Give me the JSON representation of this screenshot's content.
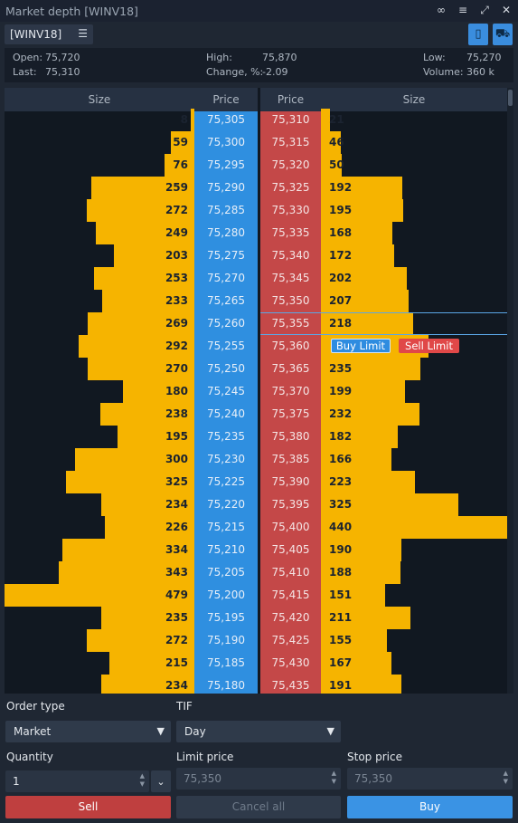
{
  "window": {
    "title": "Market depth [WINV18]"
  },
  "symbol": {
    "tab_label": "[WINV18]"
  },
  "stats": {
    "open_label": "Open:",
    "open": "75,720",
    "last_label": "Last:",
    "last": "75,310",
    "high_label": "High:",
    "high": "75,870",
    "change_label": "Change, %:",
    "change": "-2.09",
    "low_label": "Low:",
    "low": "75,270",
    "volume_label": "Volume:",
    "volume": "360 k"
  },
  "book": {
    "headers": [
      "Size",
      "Price",
      "Price",
      "Size"
    ],
    "max_size": 479,
    "rows": [
      {
        "bid_size": "8",
        "bid_price": "75,305",
        "ask_price": "75,310",
        "ask_size": "21"
      },
      {
        "bid_size": "59",
        "bid_price": "75,300",
        "ask_price": "75,315",
        "ask_size": "46"
      },
      {
        "bid_size": "76",
        "bid_price": "75,295",
        "ask_price": "75,320",
        "ask_size": "50"
      },
      {
        "bid_size": "259",
        "bid_price": "75,290",
        "ask_price": "75,325",
        "ask_size": "192"
      },
      {
        "bid_size": "272",
        "bid_price": "75,285",
        "ask_price": "75,330",
        "ask_size": "195"
      },
      {
        "bid_size": "249",
        "bid_price": "75,280",
        "ask_price": "75,335",
        "ask_size": "168"
      },
      {
        "bid_size": "203",
        "bid_price": "75,275",
        "ask_price": "75,340",
        "ask_size": "172"
      },
      {
        "bid_size": "253",
        "bid_price": "75,270",
        "ask_price": "75,345",
        "ask_size": "202"
      },
      {
        "bid_size": "233",
        "bid_price": "75,265",
        "ask_price": "75,350",
        "ask_size": "207"
      },
      {
        "bid_size": "269",
        "bid_price": "75,260",
        "ask_price": "75,355",
        "ask_size": "218"
      },
      {
        "bid_size": "292",
        "bid_price": "75,255",
        "ask_price": "75,360",
        "ask_size": "",
        "ask_bar": 254
      },
      {
        "bid_size": "270",
        "bid_price": "75,250",
        "ask_price": "75,365",
        "ask_size": "235"
      },
      {
        "bid_size": "180",
        "bid_price": "75,245",
        "ask_price": "75,370",
        "ask_size": "199"
      },
      {
        "bid_size": "238",
        "bid_price": "75,240",
        "ask_price": "75,375",
        "ask_size": "232"
      },
      {
        "bid_size": "195",
        "bid_price": "75,235",
        "ask_price": "75,380",
        "ask_size": "182"
      },
      {
        "bid_size": "300",
        "bid_price": "75,230",
        "ask_price": "75,385",
        "ask_size": "166"
      },
      {
        "bid_size": "325",
        "bid_price": "75,225",
        "ask_price": "75,390",
        "ask_size": "223"
      },
      {
        "bid_size": "234",
        "bid_price": "75,220",
        "ask_price": "75,395",
        "ask_size": "325"
      },
      {
        "bid_size": "226",
        "bid_price": "75,215",
        "ask_price": "75,400",
        "ask_size": "440"
      },
      {
        "bid_size": "334",
        "bid_price": "75,210",
        "ask_price": "75,405",
        "ask_size": "190"
      },
      {
        "bid_size": "343",
        "bid_price": "75,205",
        "ask_price": "75,410",
        "ask_size": "188"
      },
      {
        "bid_size": "479",
        "bid_price": "75,200",
        "ask_price": "75,415",
        "ask_size": "151"
      },
      {
        "bid_size": "235",
        "bid_price": "75,195",
        "ask_price": "75,420",
        "ask_size": "211"
      },
      {
        "bid_size": "272",
        "bid_price": "75,190",
        "ask_price": "75,425",
        "ask_size": "155"
      },
      {
        "bid_size": "215",
        "bid_price": "75,185",
        "ask_price": "75,430",
        "ask_size": "167"
      },
      {
        "bid_size": "234",
        "bid_price": "75,180",
        "ask_price": "75,435",
        "ask_size": "191"
      }
    ],
    "highlight_row": 9,
    "hover_row": 10,
    "buy_limit_label": "Buy Limit",
    "sell_limit_label": "Sell Limit"
  },
  "order": {
    "order_type_label": "Order type",
    "order_type_value": "Market",
    "tif_label": "TIF",
    "tif_value": "Day",
    "quantity_label": "Quantity",
    "quantity_value": "1",
    "limit_price_label": "Limit price",
    "limit_price_value": "75,350",
    "stop_price_label": "Stop price",
    "stop_price_value": "75,350",
    "sell_label": "Sell",
    "cancel_all_label": "Cancel all",
    "buy_label": "Buy"
  },
  "colors": {
    "bid": "#2f8fe0",
    "ask": "#c44848",
    "volume_bar": "#f6b400",
    "buy": "#3a93e4",
    "sell": "#bf3f3f"
  }
}
